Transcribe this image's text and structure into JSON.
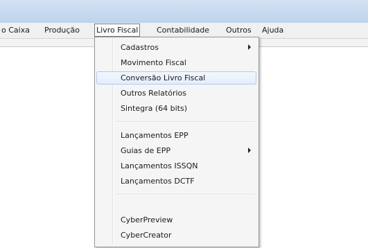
{
  "menubar": {
    "items": [
      {
        "label": "o Caixa"
      },
      {
        "label": "Produção"
      },
      {
        "label": "Livro Fiscal"
      },
      {
        "label": "Contabilidade"
      },
      {
        "label": "Outros"
      },
      {
        "label": "Ajuda"
      }
    ]
  },
  "dropdown": {
    "items": [
      {
        "label": "Cadastros",
        "has_submenu": true
      },
      {
        "label": "Movimento Fiscal"
      },
      {
        "label": "Conversão Livro Fiscal",
        "highlighted": true
      },
      {
        "label": "Outros Relatórios"
      },
      {
        "label": "Sintegra (64 bits)"
      },
      {
        "label": "Lançamentos EPP"
      },
      {
        "label": "Guias de EPP",
        "has_submenu": true
      },
      {
        "label": "Lançamentos ISSQN"
      },
      {
        "label": "Lançamentos DCTF"
      },
      {
        "label": "CyberPreview"
      },
      {
        "label": "CyberCreator"
      }
    ]
  }
}
